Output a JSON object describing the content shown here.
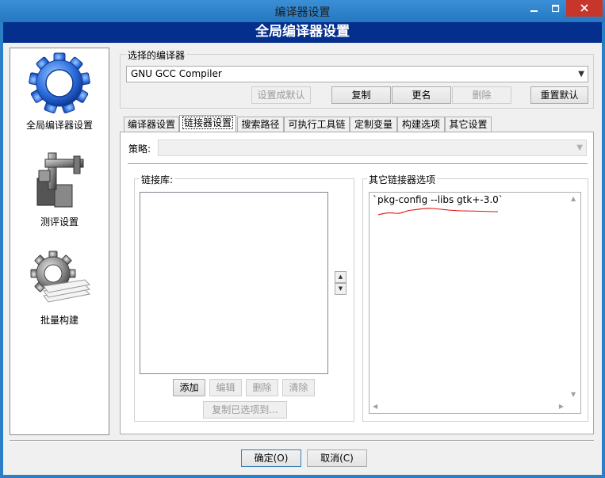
{
  "window": {
    "title": "编译器设置"
  },
  "banner": {
    "title": "全局编译器设置"
  },
  "sidebar": {
    "items": [
      {
        "label": "全局编译器设置",
        "icon": "gear-icon"
      },
      {
        "label": "测评设置",
        "icon": "caliper-icon"
      },
      {
        "label": "批量构建",
        "icon": "batch-build-icon"
      }
    ]
  },
  "compiler_select": {
    "label": "选择的编译器",
    "value": "GNU GCC Compiler",
    "buttons": {
      "set_default": "设置成默认",
      "copy": "复制",
      "rename": "更名",
      "delete": "删除",
      "reset_default": "重置默认"
    }
  },
  "tabs": [
    "编译器设置",
    "链接器设置",
    "搜索路径",
    "可执行工具链",
    "定制变量",
    "构建选项",
    "其它设置"
  ],
  "linker": {
    "policy_label": "策略:",
    "libs_label": "链接库:",
    "buttons": {
      "add": "添加",
      "edit": "编辑",
      "delete": "删除",
      "clear": "清除",
      "copy_selected": "复制已选项到..."
    },
    "other_options_label": "其它链接器选项",
    "other_options_value": "`pkg-config --libs gtk+-3.0`"
  },
  "dialog_buttons": {
    "ok": "确定(O)",
    "cancel": "取消(C)"
  },
  "colors": {
    "banner": "#052f8d",
    "title_bar": "#2a7fc6",
    "close": "#c7352b",
    "annotation": "#e01010"
  }
}
